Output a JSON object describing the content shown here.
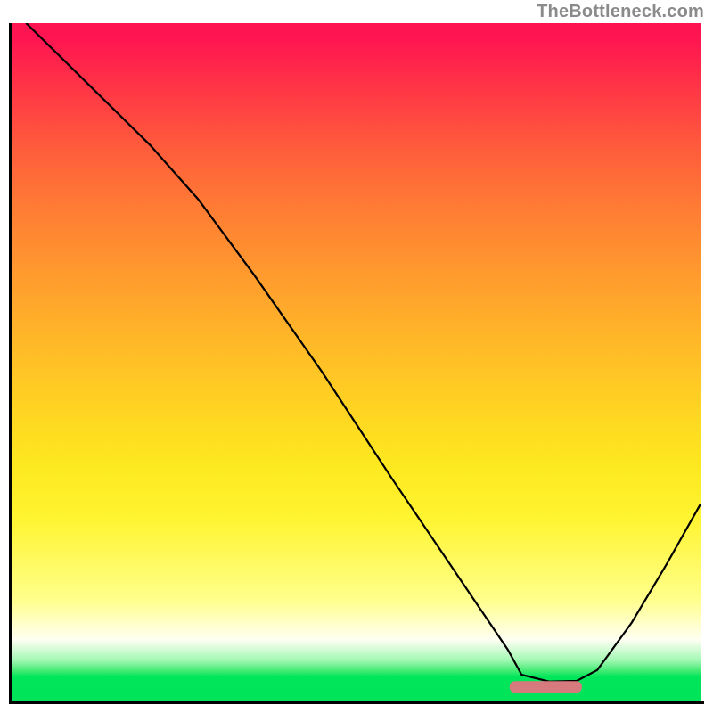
{
  "watermark": "TheBottleneck.com",
  "chart_data": {
    "type": "line",
    "title": "",
    "xlabel": "",
    "ylabel": "",
    "xlim": [
      0,
      100
    ],
    "ylim": [
      0,
      100
    ],
    "grid": false,
    "legend": false,
    "background_gradient": {
      "orientation": "vertical",
      "stops": [
        {
          "pos": 0.0,
          "color": "#ff1452"
        },
        {
          "pos": 0.5,
          "color": "#ffc825"
        },
        {
          "pos": 0.73,
          "color": "#fff430"
        },
        {
          "pos": 0.91,
          "color": "#fffff3"
        },
        {
          "pos": 0.96,
          "color": "#00e65a"
        },
        {
          "pos": 1.0,
          "color": "#00e35a"
        }
      ]
    },
    "series": [
      {
        "name": "bottleneck-curve",
        "x": [
          2,
          10,
          20,
          27,
          35,
          45,
          55,
          65,
          72,
          74,
          78,
          82,
          85,
          90,
          95,
          100
        ],
        "y": [
          100,
          92,
          82,
          74,
          63,
          48.5,
          33,
          18,
          7.5,
          3.8,
          2.8,
          2.9,
          4.5,
          11.5,
          20,
          29
        ],
        "color": "#000000",
        "linewidth": 2.2
      }
    ],
    "markers": [
      {
        "name": "optimal-marker",
        "shape": "rounded-bar",
        "x_center": 77.5,
        "x_width": 10.5,
        "y": 2.0,
        "color": "#d77a7d"
      }
    ]
  }
}
